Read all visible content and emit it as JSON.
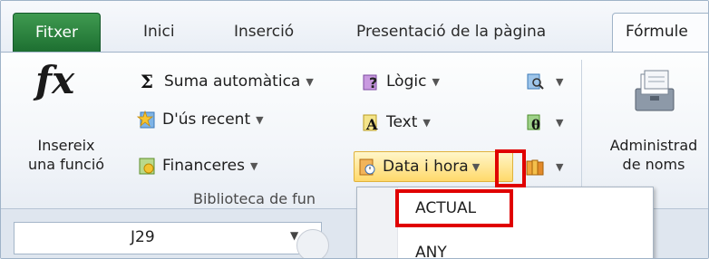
{
  "tabs": {
    "file": "Fitxer",
    "items": [
      "Inici",
      "Inserció",
      "Presentació de la pàgina"
    ],
    "active": "Fórmule"
  },
  "ribbon": {
    "insert_function": [
      "Insereix",
      "una funció"
    ],
    "autosum": "Suma automàtica",
    "recently_used": "D'ús recent",
    "financial": "Financeres",
    "logical": "Lògic",
    "text": "Text",
    "date_time": "Data i hora",
    "group_label": "Biblioteca de fun",
    "name_manager": [
      "Administrad",
      "de noms"
    ]
  },
  "namebox": {
    "value": "J29"
  },
  "menu": {
    "items": [
      "ACTUAL",
      "ANY"
    ]
  },
  "colors": {
    "file_tab": "#2a7f3c",
    "highlight": "#e00000",
    "hover": "#ffd96b"
  }
}
